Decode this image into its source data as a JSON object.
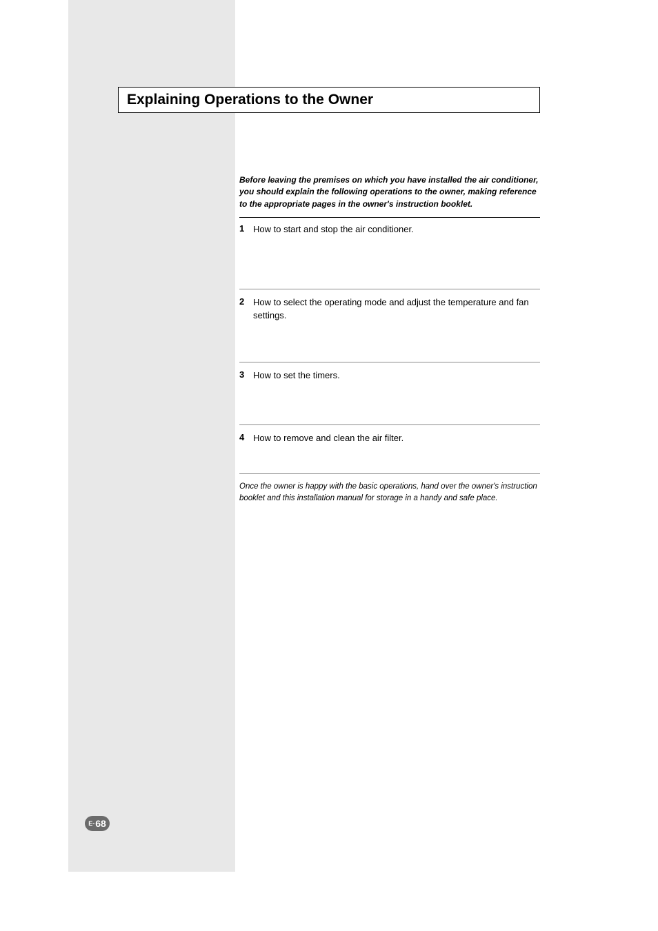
{
  "header": {
    "title": "Explaining Operations to the Owner"
  },
  "intro": "Before leaving the premises on which you have installed the air conditioner, you should explain the following operations to the owner, making reference to the appropriate pages in the owner's instruction booklet.",
  "steps": [
    {
      "num": "1",
      "text": "How to start and stop the air conditioner."
    },
    {
      "num": "2",
      "text": "How to select the operating mode and adjust the temperature and fan settings."
    },
    {
      "num": "3",
      "text": "How to set the timers."
    },
    {
      "num": "4",
      "text": "How to remove and clean the air filter."
    }
  ],
  "closing": "Once the owner is happy with the basic operations, hand over the owner's instruction booklet and this installation manual for storage in a handy and safe place.",
  "page": {
    "prefix": "E-",
    "number": "68"
  }
}
